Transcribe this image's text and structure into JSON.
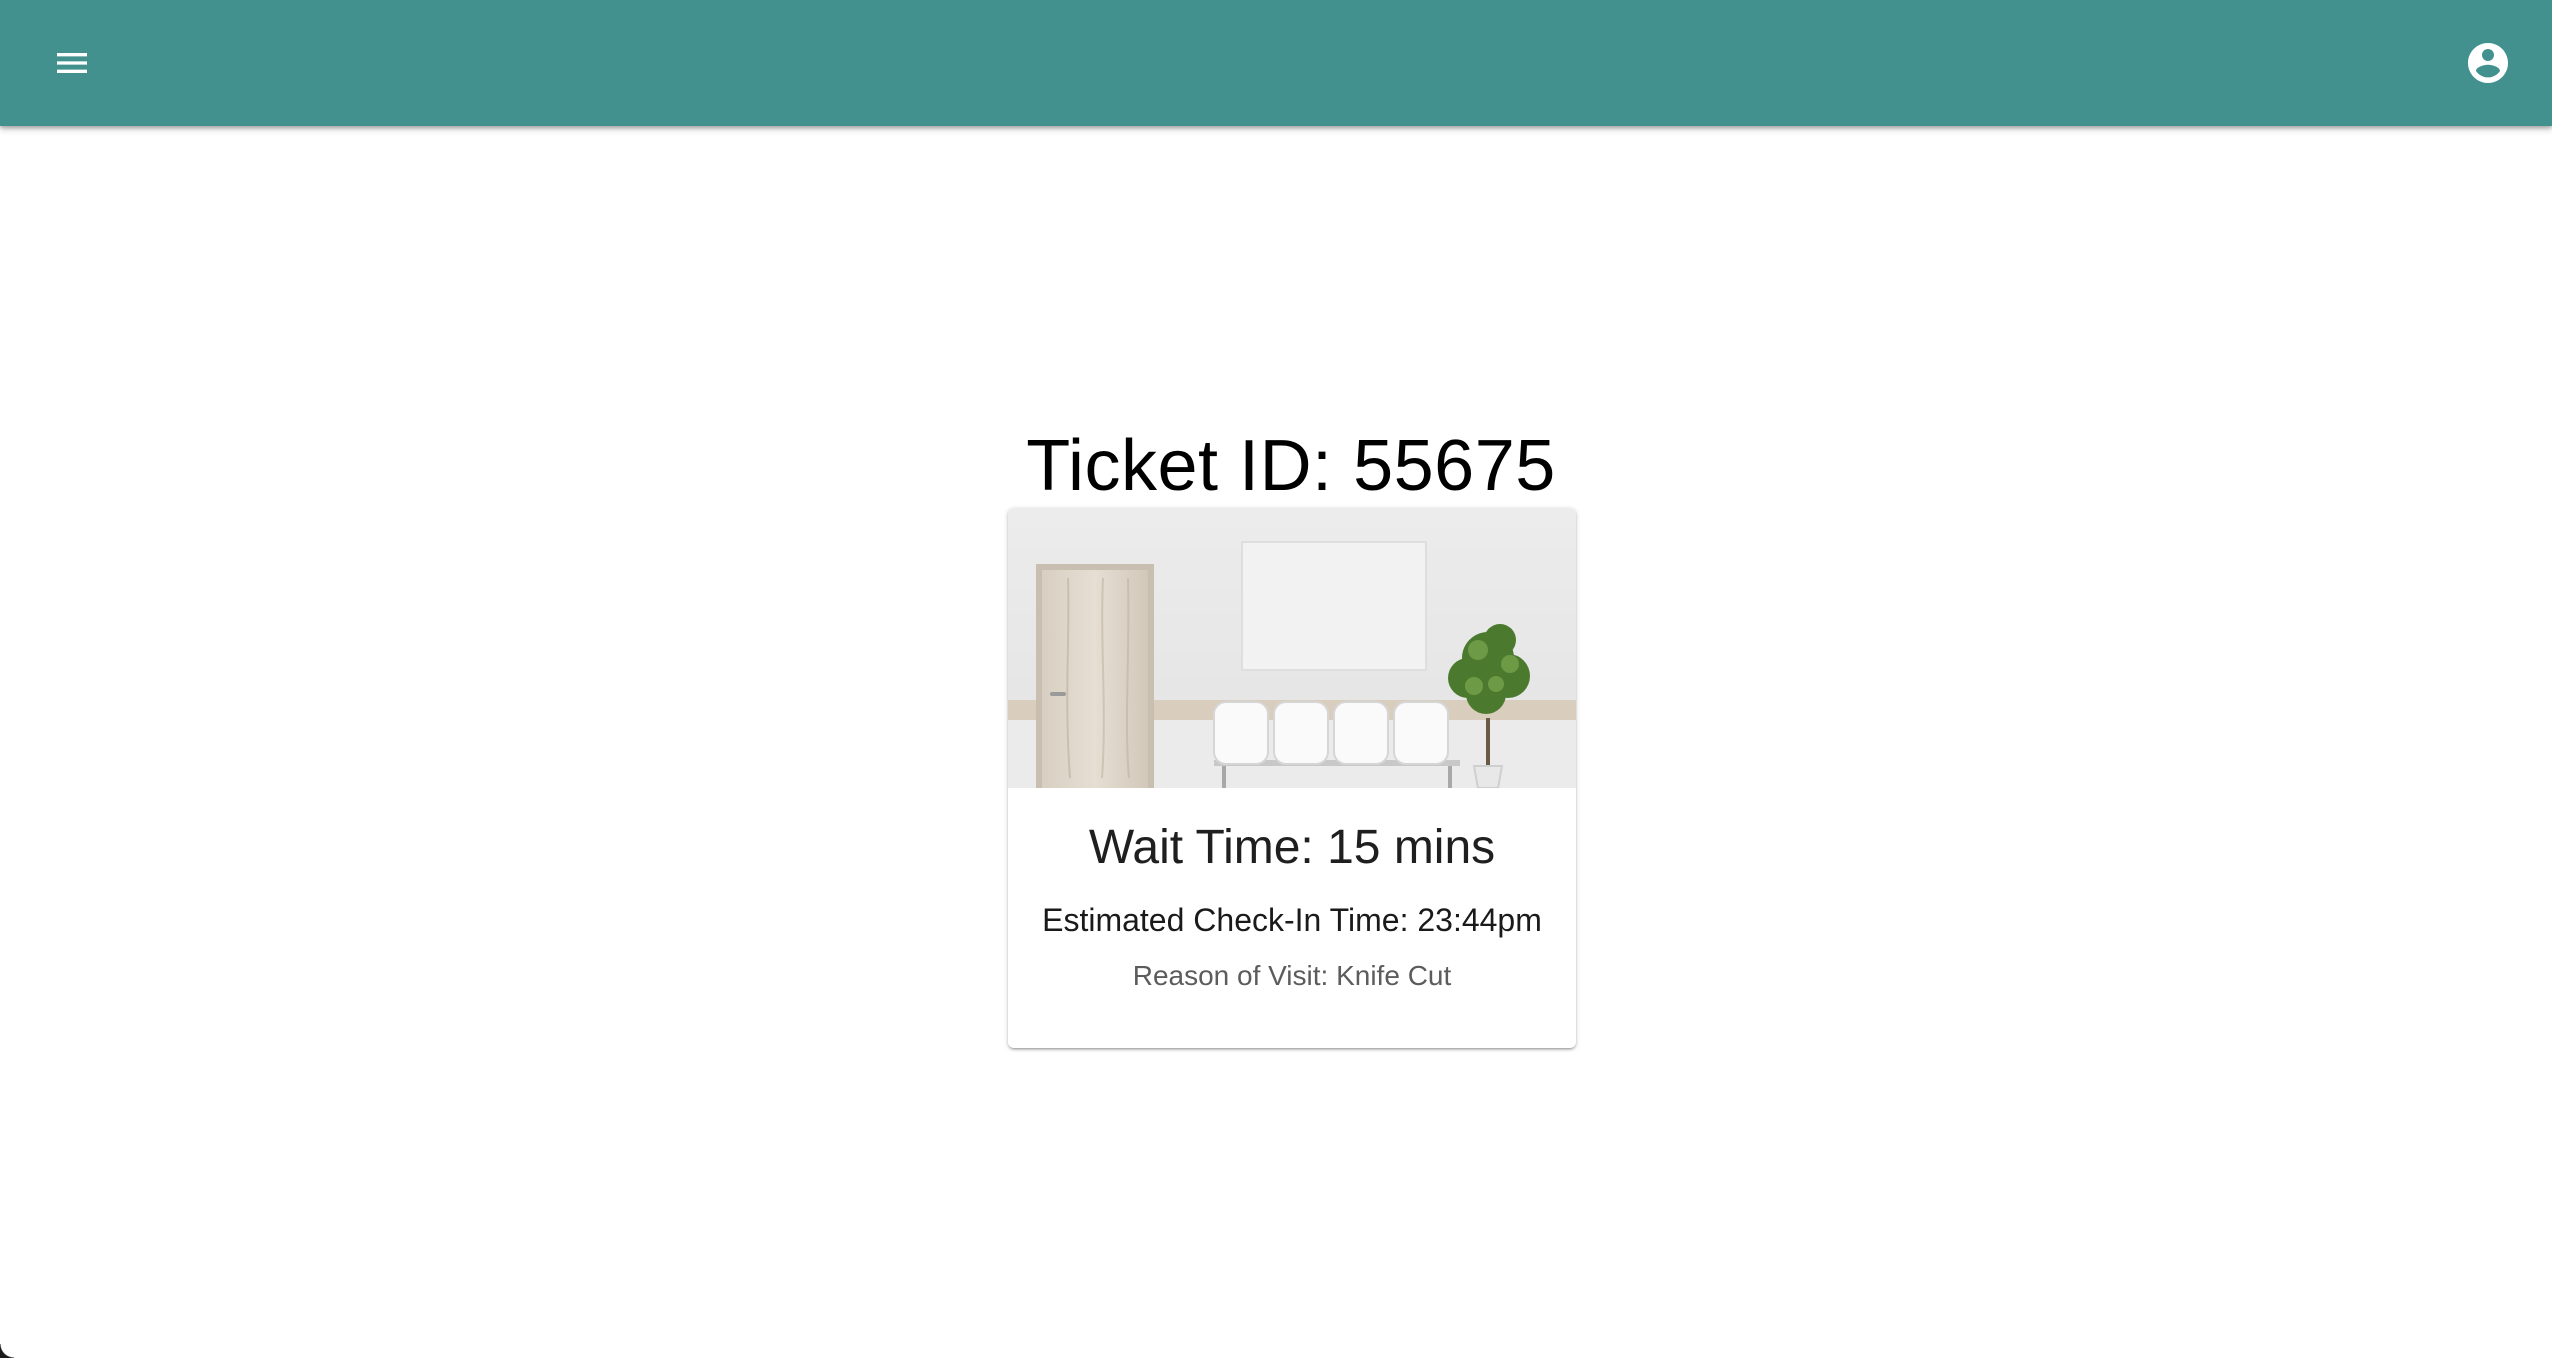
{
  "appbar": {
    "color": "#42918f",
    "menu_icon": "menu-icon",
    "account_icon": "account-circle-icon"
  },
  "ticket": {
    "title": "Ticket ID: 55675"
  },
  "card": {
    "image": "waiting-room-photo",
    "wait_time": "Wait Time: 15 mins",
    "checkin_time": "Estimated Check-In Time: 23:44pm",
    "reason": "Reason of Visit: Knife Cut"
  }
}
